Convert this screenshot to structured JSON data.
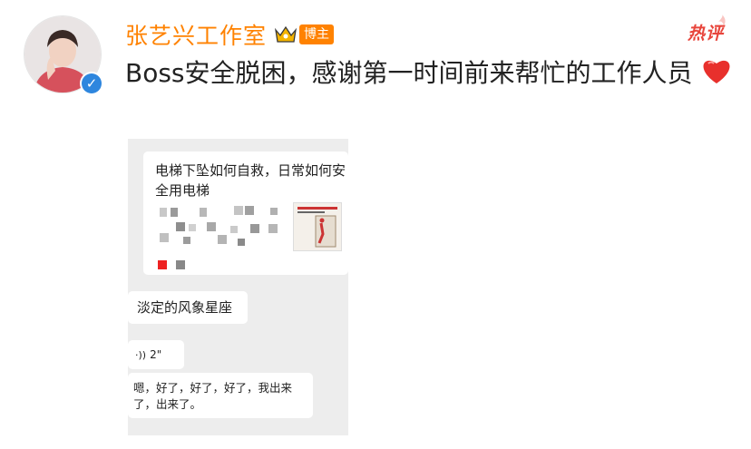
{
  "user": {
    "name": "张艺兴工作室",
    "badge": "博主",
    "verified_color": "#2e86de",
    "name_color": "#ff8200"
  },
  "tag": {
    "hot_comment": "热评",
    "color": "#e8453c"
  },
  "post": {
    "text": "Boss安全脱困，感谢第一时间前来帮忙的工作人员",
    "emoji": "heart-icon"
  },
  "screenshot": {
    "card_title": "电梯下坠如何自救，日常如何安全用电梯",
    "messages": [
      {
        "text": "淡定的风象星座"
      },
      {
        "text": "2\"",
        "type": "voice"
      },
      {
        "text": "嗯，好了，好了，好了，我出来了，出来了。"
      }
    ]
  }
}
